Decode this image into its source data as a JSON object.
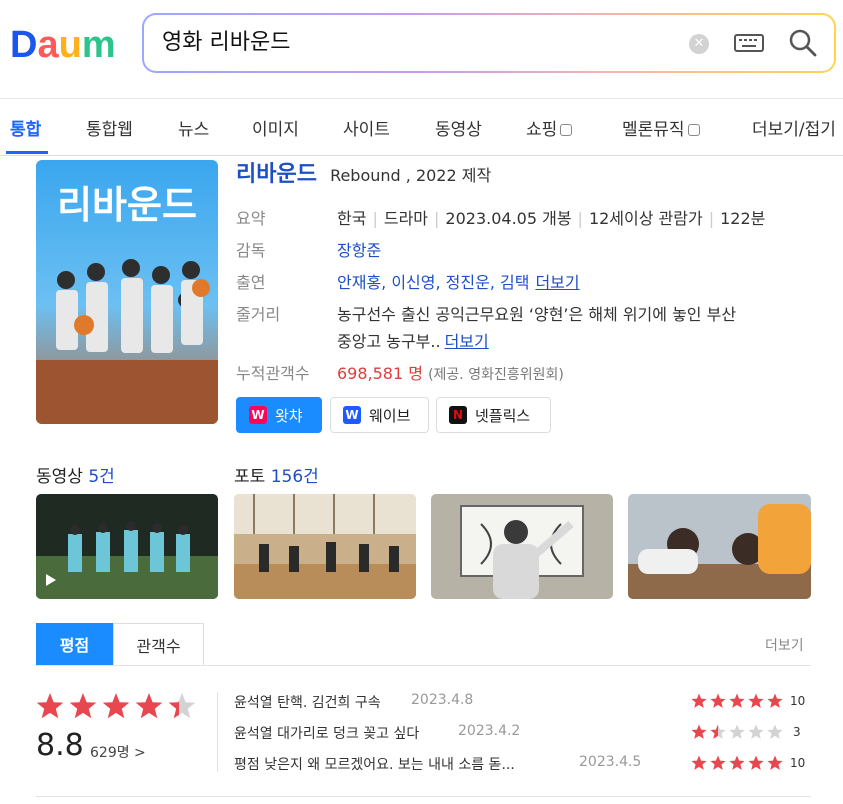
{
  "brand": {
    "logo_text": "Daum"
  },
  "search": {
    "query": "영화 리바운드"
  },
  "tabs": [
    {
      "label": "통합",
      "active": true
    },
    {
      "label": "통합웹"
    },
    {
      "label": "뉴스"
    },
    {
      "label": "이미지"
    },
    {
      "label": "사이트"
    },
    {
      "label": "동영상"
    },
    {
      "label": "쇼핑"
    },
    {
      "label": "멜론뮤직"
    },
    {
      "label": "더보기/접기"
    }
  ],
  "movie": {
    "title": "리바운드",
    "subtitle": "Rebound , 2022 제작",
    "poster_title": "리바운드",
    "labels": {
      "summary": "요약",
      "director": "감독",
      "cast": "출연",
      "plot": "줄거리",
      "audience": "누적관객수"
    },
    "summary": {
      "country": "한국",
      "genre": "드라마",
      "release": "2023.04.05 개봉",
      "rating": "12세이상 관람가",
      "runtime": "122분"
    },
    "director": "장항준",
    "cast": "안재홍, 이신영, 정진운, 김택",
    "cast_more": "더보기",
    "plot_line1": "농구선수 출신 공익근무요원 ‘양현’은 해체 위기에 놓인 부산",
    "plot_line2": "중앙고 농구부..",
    "plot_more": "더보기",
    "audience_count": "698,581 명",
    "audience_source": "(제공. 영화진흥위원회)"
  },
  "ott": [
    {
      "name": "왓챠",
      "logo": "W",
      "color": "#ff0558"
    },
    {
      "name": "웨이브",
      "logo": "W",
      "color": "#1f5cff"
    },
    {
      "name": "넷플릭스",
      "logo": "N",
      "color": "#e50914"
    }
  ],
  "media": {
    "video_label": "동영상",
    "video_count": "5건",
    "photo_label": "포토",
    "photo_count": "156건"
  },
  "rating": {
    "tab_active": "평점",
    "tab_other": "관객수",
    "more": "더보기",
    "score": "8.8",
    "count": "629명 >",
    "stars": 4.4,
    "reviews": [
      {
        "text": "윤석열 탄핵. 김건희 구속",
        "date": "2023.4.8",
        "score": "10",
        "stars": 5
      },
      {
        "text": "윤석열 대가리로 덩크 꽂고 싶다",
        "date": "2023.4.2",
        "score": "3",
        "stars": 1.5
      },
      {
        "text": "평점 낮은지 왜 모르겠어요. 보는 내내 소름 돋...",
        "date": "2023.4.5",
        "score": "10",
        "stars": 5
      }
    ]
  },
  "colors": {
    "accent": "#1a66ff",
    "brand_blue": "#1d4fc6",
    "star_red": "#e8474f"
  }
}
